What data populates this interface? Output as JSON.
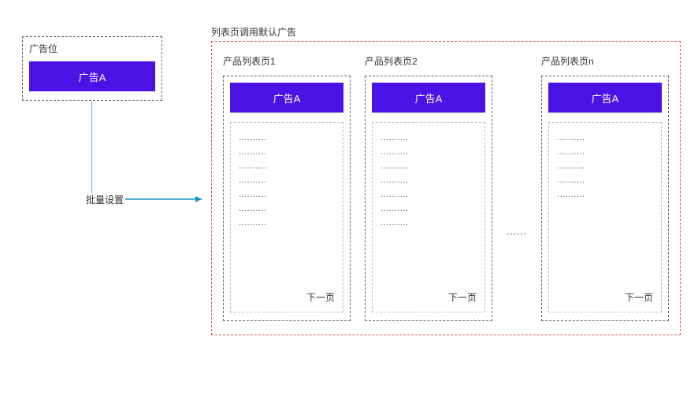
{
  "adSlot": {
    "title": "广告位",
    "adLabel": "广告A"
  },
  "batchLabel": "批量设置",
  "container": {
    "title": "列表页调用默认广告"
  },
  "pages": [
    {
      "title": "产品列表页1",
      "adLabel": "广告A",
      "next": "下一页",
      "rowCount": 7
    },
    {
      "title": "产品列表页2",
      "adLabel": "广告A",
      "next": "下一页",
      "rowCount": 7
    },
    {
      "title": "产品列表页n",
      "adLabel": "广告A",
      "next": "下一页",
      "rowCount": 5
    }
  ],
  "ellipsis": "......",
  "rowDots": ".........."
}
